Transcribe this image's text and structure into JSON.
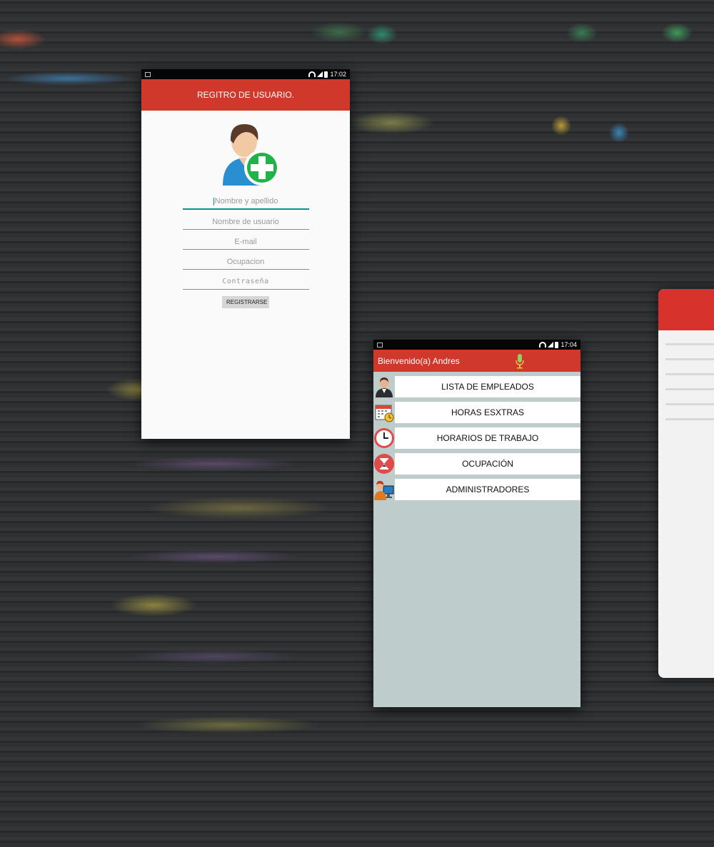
{
  "phone1": {
    "status_time": "17:02",
    "title": "REGITRO DE USUARIO.",
    "fields": [
      {
        "placeholder": "Nombre y apellido"
      },
      {
        "placeholder": "Nombre de usuario"
      },
      {
        "placeholder": "E-mail"
      },
      {
        "placeholder": "Ocupacion"
      },
      {
        "placeholder": "Contraseña"
      }
    ],
    "register_label": "REGISTRARSE"
  },
  "phone2": {
    "status_time": "17:04",
    "title": "Bienvenido(a) Andres",
    "menu": [
      {
        "label": "LISTA DE EMPLEADOS",
        "icon": "employee-icon"
      },
      {
        "label": "HORAS ESXTRAS",
        "icon": "calendar-clock-icon"
      },
      {
        "label": "HORARIOS DE TRABAJO",
        "icon": "clock-icon"
      },
      {
        "label": "OCUPACIÓN",
        "icon": "hourglass-icon"
      },
      {
        "label": "ADMINISTRADORES",
        "icon": "admin-computer-icon"
      }
    ]
  },
  "colors": {
    "appbar": "#d0382c",
    "accent": "#009688",
    "menu_bg": "#bfcccc"
  }
}
